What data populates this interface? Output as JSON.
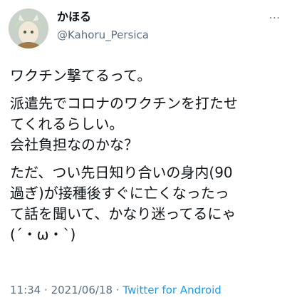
{
  "user": {
    "display_name": "かほる",
    "handle": "@Kahoru_Persica"
  },
  "tweet": {
    "paragraphs": [
      [
        "ワクチン撃てるって。"
      ],
      [
        "派遣先でコロナのワクチンを打たせ",
        "てくれるらしい。",
        "会社負担なのかな？"
      ],
      [
        "ただ、つい先日知り合いの身内(90",
        "過ぎ)が接種後すぐに亡くなったっ",
        "て話を聞いて、かなり迷ってるにゃ",
        "(´・ω・`)"
      ]
    ],
    "time": "11:34",
    "dot": "·",
    "date": "2021/06/18",
    "source": "Twitter for Android"
  },
  "icons": {
    "more": "more-options-icon",
    "avatar": "avatar-image"
  }
}
